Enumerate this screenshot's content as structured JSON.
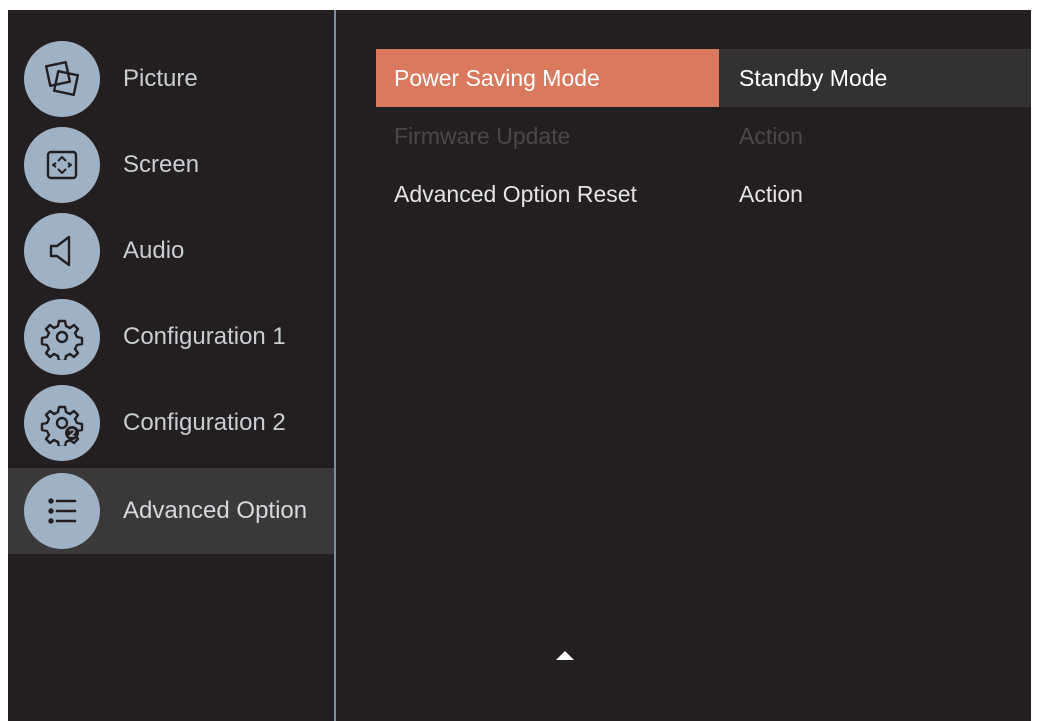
{
  "sidebar": {
    "items": [
      {
        "label": "Picture",
        "icon": "picture-icon"
      },
      {
        "label": "Screen",
        "icon": "screen-icon"
      },
      {
        "label": "Audio",
        "icon": "audio-icon"
      },
      {
        "label": "Configuration 1",
        "icon": "gear-icon"
      },
      {
        "label": "Configuration 2",
        "icon": "gear-2-icon"
      },
      {
        "label": "Advanced Option",
        "icon": "list-icon",
        "selected": true
      }
    ]
  },
  "main": {
    "rows": [
      {
        "label": "Power Saving Mode",
        "value": "Standby Mode",
        "state": "active"
      },
      {
        "label": "Firmware Update",
        "value": "Action",
        "state": "disabled"
      },
      {
        "label": "Advanced Option Reset",
        "value": "Action",
        "state": "normal"
      }
    ],
    "scroll_indicator": "up-arrow-icon"
  },
  "colors": {
    "background": "#231f20",
    "highlight": "#d97a5e",
    "icon_circle": "#9fb1c4",
    "divider": "#7b8fa6"
  }
}
